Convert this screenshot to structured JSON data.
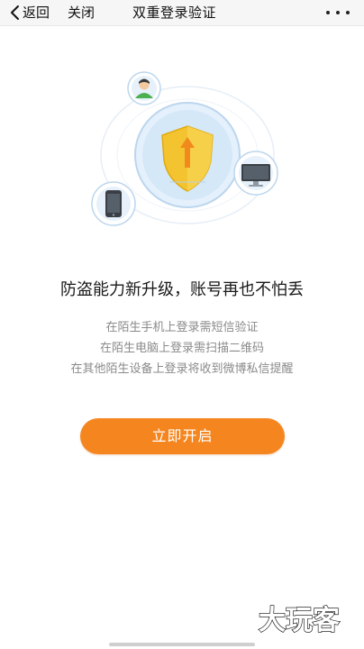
{
  "nav": {
    "back_label": "返回",
    "close_label": "关闭",
    "title": "双重登录验证"
  },
  "icons": {
    "back": "chevron-left-icon",
    "more": "more-dots-icon",
    "user": "user-avatar-icon",
    "shield": "shield-upgrade-icon",
    "monitor": "computer-monitor-icon",
    "phone": "mobile-phone-icon"
  },
  "main": {
    "headline": "防盗能力新升级，账号再也不怕丢",
    "descriptions": [
      "在陌生手机上登录需短信验证",
      "在陌生电脑上登录需扫描二维码",
      "在其他陌生设备上登录将收到微博私信提醒"
    ],
    "cta_label": "立即开启"
  },
  "watermark": {
    "text": "大玩客"
  },
  "colors": {
    "accent": "#f5861f",
    "shield": "#f4c430",
    "circle": "#d6e9f8",
    "navbar": "#f6f6f6"
  }
}
